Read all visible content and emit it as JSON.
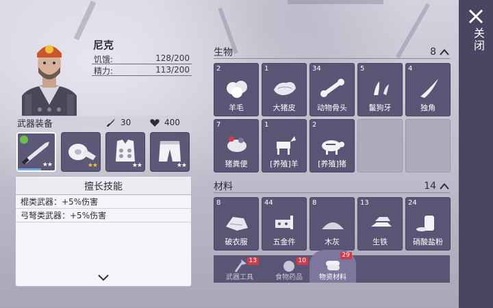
{
  "character": {
    "name": "尼克",
    "stats": [
      {
        "label": "饥饿:",
        "value": "128/200"
      },
      {
        "label": "精力:",
        "value": "113/200"
      }
    ]
  },
  "equipment": {
    "title": "武器装备",
    "attack": "30",
    "health": "400",
    "slots": [
      {
        "name": "knife-icon",
        "stars": "★★",
        "star_color": "#ffffff"
      },
      {
        "name": "bandage-icon",
        "stars": "★★",
        "star_color": "#f0c23a"
      },
      {
        "name": "vest-icon",
        "stars": "★★",
        "star_color": "#ffffff"
      },
      {
        "name": "pants-icon",
        "stars": "★★",
        "star_color": "#ffffff"
      }
    ]
  },
  "skills": {
    "title": "擅长技能",
    "rows": [
      "棍类武器：+5%伤害",
      "弓弩类武器：+5%伤害"
    ]
  },
  "inventory": {
    "biology": {
      "title": "生物",
      "count": "8",
      "items": [
        {
          "qty": "2",
          "label": "羊毛"
        },
        {
          "qty": "1",
          "label": "大猪皮"
        },
        {
          "qty": "34",
          "label": "动物骨头"
        },
        {
          "qty": "5",
          "label": "鬣狗牙"
        },
        {
          "qty": "4",
          "label": "独角"
        },
        {
          "qty": "7",
          "label": "猪粪便"
        },
        {
          "qty": "1",
          "label": "[养殖]羊"
        },
        {
          "qty": "2",
          "label": "[养殖]猪"
        }
      ]
    },
    "materials": {
      "title": "材料",
      "count": "14",
      "items": [
        {
          "qty": "8",
          "label": "破衣服"
        },
        {
          "qty": "44",
          "label": "五金件"
        },
        {
          "qty": "8",
          "label": "木灰"
        },
        {
          "qty": "13",
          "label": "生铁"
        },
        {
          "qty": "24",
          "label": "硝酸盐粉"
        }
      ]
    }
  },
  "tabs": [
    {
      "label": "武器工具",
      "badge": "13"
    },
    {
      "label": "食物药品",
      "badge": "10"
    },
    {
      "label": "物资材料",
      "badge": "29"
    }
  ],
  "close": {
    "label": "关闭"
  },
  "colors": {
    "panel": "#5b5575",
    "badge": "#d13b4a",
    "closebar": "#4a4562"
  }
}
